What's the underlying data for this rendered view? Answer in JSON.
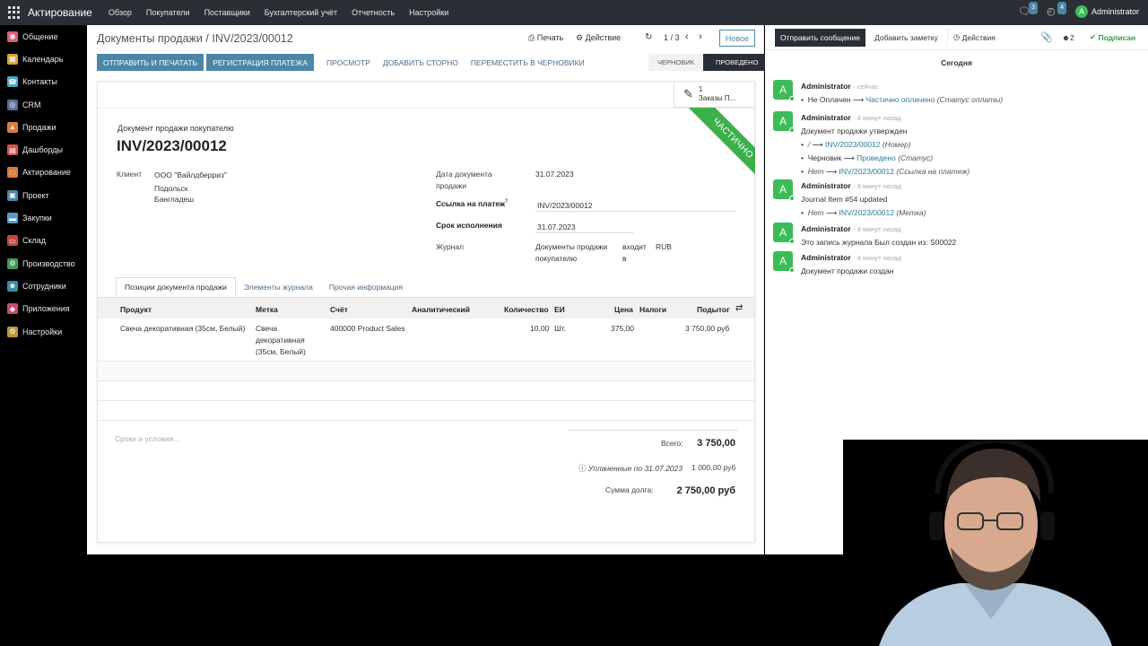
{
  "topbar": {
    "app_name": "Актирование",
    "menu": [
      "Обзор",
      "Покупатели",
      "Поставщики",
      "Бухгалтерский учёт",
      "Отчетность",
      "Настройки"
    ],
    "chat_count": "3",
    "activity_count": "4",
    "user": "Administrator",
    "avatar_letter": "A"
  },
  "sidebar": {
    "items": [
      {
        "label": "Общение",
        "color": "#e05c7b"
      },
      {
        "label": "Календарь",
        "color": "#d9a23b"
      },
      {
        "label": "Контакты",
        "color": "#4aa9c6"
      },
      {
        "label": "CRM",
        "color": "#5a6e9a"
      },
      {
        "label": "Продажи",
        "color": "#e07b3b"
      },
      {
        "label": "Дашборды",
        "color": "#d9534f"
      },
      {
        "label": "Актирование",
        "color": "#d97b3b"
      },
      {
        "label": "Проект",
        "color": "#4b86a8"
      },
      {
        "label": "Закупки",
        "color": "#5a9ec6"
      },
      {
        "label": "Склад",
        "color": "#c9453b"
      },
      {
        "label": "Производство",
        "color": "#3d9b5a"
      },
      {
        "label": "Сотрудники",
        "color": "#3b8ea8"
      },
      {
        "label": "Приложения",
        "color": "#c94a6b"
      },
      {
        "label": "Настройки",
        "color": "#b89a3b"
      }
    ]
  },
  "header": {
    "breadcrumb_parent": "Документы продажи",
    "breadcrumb_sep": "/",
    "breadcrumb_current": "INV/2023/00012",
    "print_label": "Печать",
    "action_label": "Действие",
    "pager": "1 / 3",
    "new_label": "Новое"
  },
  "actions": {
    "send_print": "Отправить и печатать",
    "register_payment": "Регистрация платежа",
    "preview": "Просмотр",
    "add_reversal": "Добавить сторно",
    "to_draft": "Переместить в черновики"
  },
  "status": {
    "draft": "Черновик",
    "posted": "Проведено"
  },
  "sheet": {
    "smart_count": "1",
    "smart_label": "Заказы П...",
    "ribbon": "Частично",
    "doc_type": "Документ продажи покупателю",
    "doc_name": "INV/2023/00012",
    "client_label": "Клиент",
    "client_lines": [
      "ООО \"Вайлдберриз\"",
      "Подольск",
      "Бангладеш"
    ],
    "invoice_date_label_1": "Дата документа",
    "invoice_date_label_2": "продажи",
    "invoice_date": "31.07.2023",
    "payment_ref_label": "Ссылка на платеж",
    "payment_ref_sup": "?",
    "payment_ref": "INV/2023/00012",
    "due_label": "Срок исполнения",
    "due_date": "31.07.2023",
    "journal_label": "Журнал",
    "journal_1": "Документы продажи",
    "journal_2": "покупателю",
    "journal_in_1": "входит",
    "journal_in_2": "в",
    "currency": "RUB"
  },
  "tabs": [
    "Позиции документа продажи",
    "Элементы журнала",
    "Прочая информация"
  ],
  "table": {
    "headers": [
      "Продукт",
      "Метка",
      "Счёт",
      "Аналитический",
      "Количество",
      "ЕИ",
      "Цена",
      "Налоги",
      "Подытог"
    ],
    "rows": [
      {
        "product": "Свеча декоративная (35см, Белый)",
        "label_1": "Свеча",
        "label_2": "декоративная",
        "label_3": "(35см, Белый)",
        "account": "400000 Product Sales",
        "qty": "10,00",
        "uom": "Шт.",
        "price": "375,00",
        "subtotal": "3 750,00 руб"
      }
    ]
  },
  "footer": {
    "terms_placeholder": "Сроки и условия...",
    "total_label": "Всего:",
    "total": "3 750,00",
    "paid_label": "Уплаченные по 31.07.2023",
    "paid": "1 000,00 руб",
    "due_label": "Сумма долга:",
    "due": "2 750,00 руб"
  },
  "chatter": {
    "send_message": "Отправить сообщение",
    "log_note": "Добавить заметку",
    "activities": "Действия",
    "followers": "2",
    "subscribed": "Подписан",
    "today": "Сегодня",
    "messages": [
      {
        "author": "Administrator",
        "time": "- сейчас",
        "lines": [
          {
            "from": "Не Оплачен",
            "to": "Частично оплачено",
            "field": "(Статус оплаты)"
          }
        ]
      },
      {
        "author": "Administrator",
        "time": "- 8 минут назад",
        "text": "Документ продажи утвержден",
        "lines": [
          {
            "from": "/",
            "to": "INV/2023/00012",
            "field": "(Номер)"
          },
          {
            "from": "Черновик",
            "to": "Проведено",
            "field": "(Статус)"
          },
          {
            "from": "Нет",
            "to": "INV/2023/00012",
            "field": "(Ссылка на платеж)"
          }
        ]
      },
      {
        "author": "Administrator",
        "time": "- 8 минут назад",
        "text": "Journal Item #54 updated",
        "lines": [
          {
            "from": "Нет",
            "to": "INV/2023/00012",
            "field": "(Метка)"
          }
        ]
      },
      {
        "author": "Administrator",
        "time": "- 8 минут назад",
        "text": "Это запись журнала Был создан из: S00022",
        "lines": []
      },
      {
        "author": "Administrator",
        "time": "- 8 минут назад",
        "text": "Документ продажи создан",
        "lines": []
      }
    ]
  }
}
